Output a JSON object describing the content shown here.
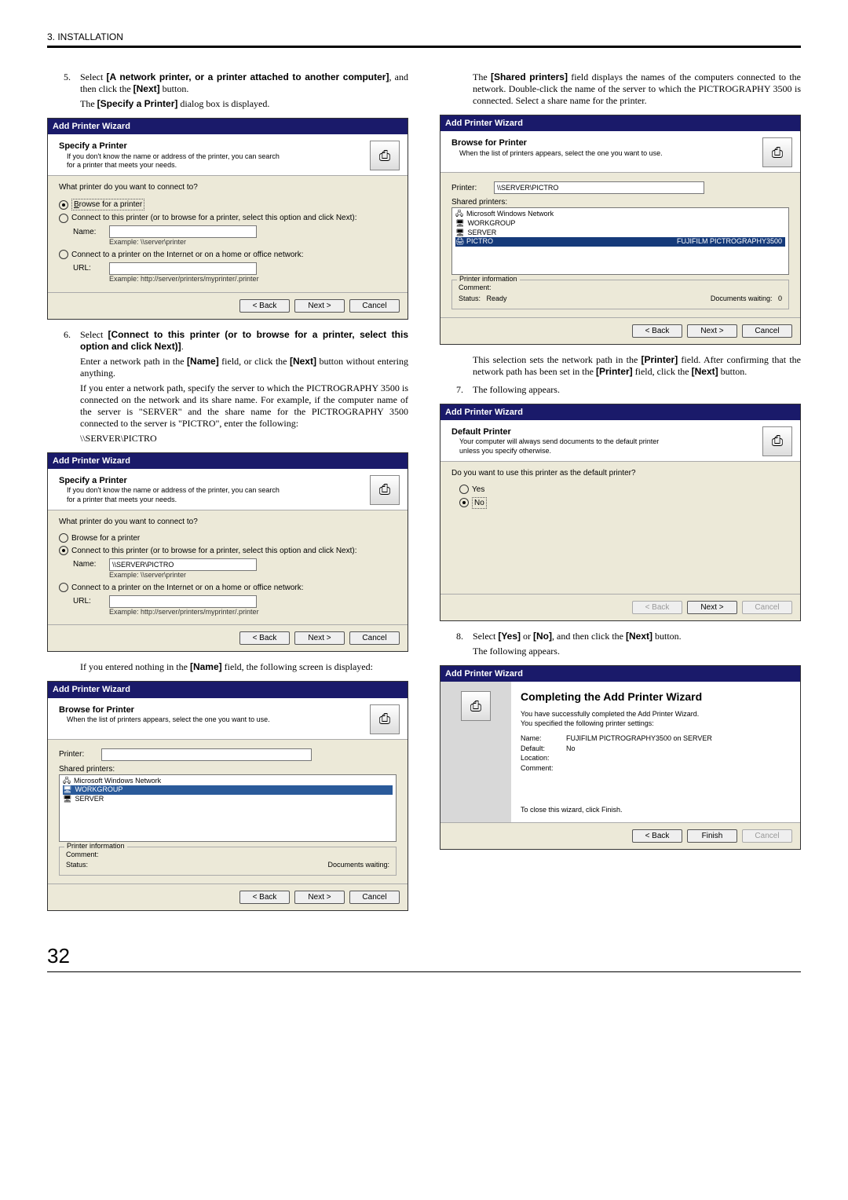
{
  "page": {
    "section": "3. INSTALLATION",
    "number": "32"
  },
  "wizard_title": "Add Printer Wizard",
  "printer_glyph": "⎙",
  "buttons": {
    "back": "< Back",
    "next": "Next >",
    "cancel": "Cancel",
    "finish": "Finish"
  },
  "specify": {
    "title": "Specify a Printer",
    "sub": "If you don't know the name or address of the printer, you can search for a printer that meets your needs.",
    "question": "What printer do you want to connect to?",
    "opt_browse": "Browse for a printer",
    "opt_connect": "Connect to this printer (or to browse for a printer, select this option and click Next):",
    "opt_internet": "Connect to a printer on the Internet or on a home or office network:",
    "name_label": "Name:",
    "url_label": "URL:",
    "example_name": "Example: \\\\server\\printer",
    "example_url": "Example: http://server/printers/myprinter/.printer",
    "filled_name": "\\\\SERVER\\PICTRO"
  },
  "browse": {
    "title": "Browse for Printer",
    "sub": "When the list of printers appears, select the one you want to use.",
    "printer_label": "Printer:",
    "shared_label": "Shared printers:",
    "net": "Microsoft Windows Network",
    "wg": "WORKGROUP",
    "srv": "SERVER",
    "pictro": "PICTRO",
    "pictro_desc": "FUJIFILM PICTROGRAPHY3500",
    "info_legend": "Printer information",
    "comment_label": "Comment:",
    "status_label": "Status:",
    "status_ready": "Ready",
    "docs_label": "Documents waiting:",
    "docs_count": "0",
    "filled_printer": "\\\\SERVER\\PICTRO"
  },
  "default": {
    "title": "Default Printer",
    "sub": "Your computer will always send documents to the default printer unless you specify otherwise.",
    "question": "Do you want to use this printer as the default printer?",
    "yes": "Yes",
    "no": "No"
  },
  "complete": {
    "heading": "Completing the Add Printer Wizard",
    "line1": "You have successfully completed the Add Printer Wizard.",
    "line2": "You specified the following printer settings:",
    "name_label": "Name:",
    "name_value": "FUJIFILM PICTROGRAPHY3500 on SERVER",
    "default_label": "Default:",
    "default_value": "No",
    "location_label": "Location:",
    "comment_label": "Comment:",
    "close_line": "To close this wizard, click Finish."
  },
  "steps": {
    "s5_num": "5.",
    "s5_a": "Select ",
    "s5_b": "[A network printer, or a printer attached to another computer]",
    "s5_c": ", and then click the ",
    "s5_d": "[Next]",
    "s5_e": " button.",
    "s5_f": "The ",
    "s5_g": "[Specify a Printer]",
    "s5_h": " dialog box is displayed.",
    "s6_num": "6.",
    "s6_a": "Select ",
    "s6_b": "[Connect to this printer (or to browse for a printer, select this option and click Next)]",
    "s6_c": ".",
    "s6_d": "Enter a network path in the ",
    "s6_e": "[Name]",
    "s6_f": " field, or click the ",
    "s6_g": "[Next]",
    "s6_h": " button without entering anything.",
    "s6_i": "If you enter a network path, specify the server to which the PICTROGRAPHY 3500 is connected on the network and its share name. For example, if the computer name of the server is \"SERVER\" and the share name for the PICTROGRAPHY 3500 connected to the server is \"PICTRO\", enter the following:",
    "s6_j": "\\\\SERVER\\PICTRO",
    "s6_after1a": "If you entered nothing in the ",
    "s6_after1b": "[Name]",
    "s6_after1c": " field, the following screen is displayed:",
    "right_intro_a": "The ",
    "right_intro_b": "[Shared printers]",
    "right_intro_c": " field displays the names of the computers connected to the network. Double-click the name of the server to which the PICTROGRAPHY 3500 is connected. Select a share name for the printer.",
    "right_after_a": "This selection sets the network path in the ",
    "right_after_b": "[Printer]",
    "right_after_c": " field. After confirming that the network path has been set in the ",
    "right_after_d": "[Printer]",
    "right_after_e": " field, click the ",
    "right_after_f": "[Next]",
    "right_after_g": " button.",
    "s7_num": "7.",
    "s7_text": "The following appears.",
    "s8_num": "8.",
    "s8_a": "Select ",
    "s8_b": "[Yes]",
    "s8_c": " or ",
    "s8_d": "[No]",
    "s8_e": ", and then click the ",
    "s8_f": "[Next]",
    "s8_g": " button.",
    "s8_h": "The following appears."
  }
}
